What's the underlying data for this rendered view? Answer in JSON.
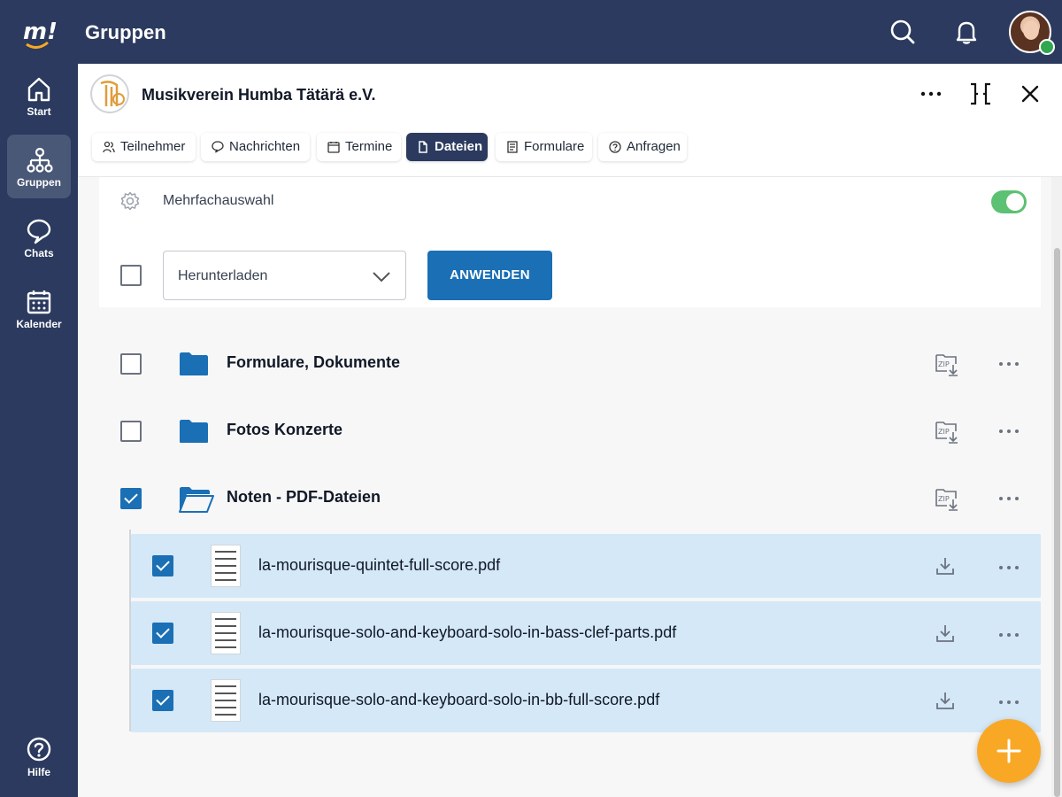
{
  "app": {
    "logo_text": "m!",
    "page_title": "Gruppen"
  },
  "sidebar": {
    "items": [
      {
        "label": "Start",
        "icon": "home-icon"
      },
      {
        "label": "Gruppen",
        "icon": "groups-icon",
        "active": true
      },
      {
        "label": "Chats",
        "icon": "chat-icon"
      },
      {
        "label": "Kalender",
        "icon": "calendar-icon"
      },
      {
        "label": "Hilfe",
        "icon": "help-icon"
      }
    ]
  },
  "topbar": {
    "icons": [
      "search-icon",
      "bell-icon",
      "avatar"
    ]
  },
  "group": {
    "name": "Musikverein Humba Tätärä e.V.",
    "tabs": [
      {
        "label": "Teilnehmer",
        "icon": "people-icon"
      },
      {
        "label": "Nachrichten",
        "icon": "message-icon"
      },
      {
        "label": "Termine",
        "icon": "calendar-icon"
      },
      {
        "label": "Dateien",
        "icon": "files-icon",
        "active": true
      },
      {
        "label": "Formulare",
        "icon": "form-icon"
      },
      {
        "label": "Anfragen",
        "icon": "question-icon"
      }
    ]
  },
  "toolbar": {
    "multi_select_label": "Mehrfachauswahl",
    "multi_select_enabled": true,
    "action_select_value": "Herunterladen",
    "apply_label": "ANWENDEN"
  },
  "folders": [
    {
      "name": "Formulare, Dokumente",
      "checked": false,
      "open": false
    },
    {
      "name": "Fotos Konzerte",
      "checked": false,
      "open": false
    },
    {
      "name": "Noten - PDF-Dateien",
      "checked": true,
      "open": true
    }
  ],
  "files": [
    {
      "name": "la-mourisque-quintet-full-score.pdf",
      "checked": true
    },
    {
      "name": "la-mourisque-solo-and-keyboard-solo-in-bass-clef-parts.pdf",
      "checked": true
    },
    {
      "name": "la-mourisque-solo-and-keyboard-solo-in-bb-full-score.pdf",
      "checked": true
    }
  ],
  "colors": {
    "navy": "#2b3a5e",
    "primary_blue": "#1a6fb5",
    "selected_row": "#d4e8f7",
    "fab_orange": "#f9a826",
    "toggle_green": "#5cc172"
  }
}
